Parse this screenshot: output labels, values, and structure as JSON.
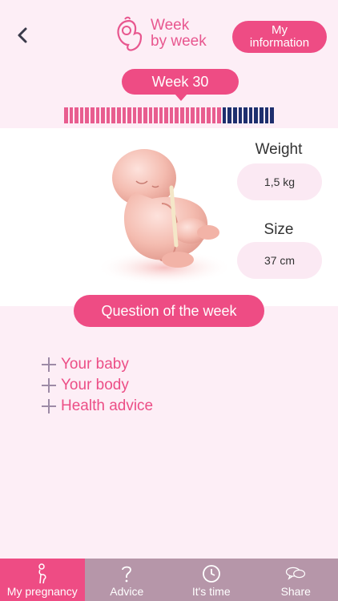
{
  "header": {
    "logo_line1": "Week",
    "logo_line2": "by week",
    "my_info_line1": "My",
    "my_info_line2": "information"
  },
  "week": {
    "label": "Week 30",
    "current": 30,
    "total": 40
  },
  "stats": {
    "weight_label": "Weight",
    "weight_value": "1,5 kg",
    "size_label": "Size",
    "size_value": "37 cm"
  },
  "question_button": "Question of the week",
  "accordion": [
    {
      "label": "Your baby"
    },
    {
      "label": "Your body"
    },
    {
      "label": "Health advice"
    }
  ],
  "tabs": [
    {
      "label": "My pregnancy",
      "icon": "pregnant-woman-icon"
    },
    {
      "label": "Advice",
      "icon": "question-mark-icon"
    },
    {
      "label": "It's time",
      "icon": "clock-icon"
    },
    {
      "label": "Share",
      "icon": "chat-bubbles-icon"
    }
  ],
  "colors": {
    "accent": "#ee4c84",
    "progress_done": "#e85d8f",
    "progress_remaining": "#1e2f6e",
    "background": "#fdeef6",
    "tabbar": "#b696a9"
  }
}
